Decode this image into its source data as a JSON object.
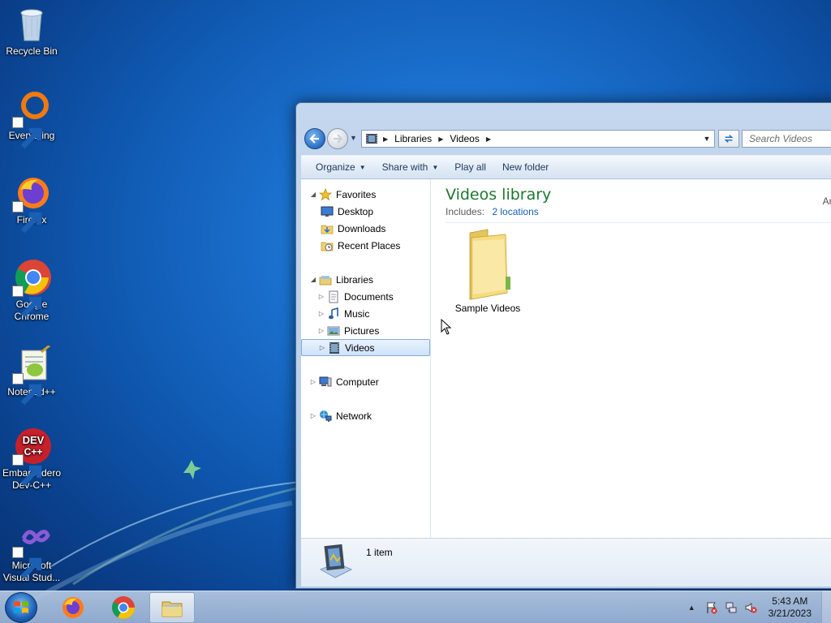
{
  "desktop": {
    "icons": [
      {
        "label": "Recycle Bin",
        "icon": "recycle-bin-icon"
      },
      {
        "label": "Everything",
        "icon": "everything-icon"
      },
      {
        "label": "Firefox",
        "icon": "firefox-icon"
      },
      {
        "label": "Google Chrome",
        "icon": "chrome-icon"
      },
      {
        "label": "Notepad++",
        "icon": "notepad-plus-plus-icon"
      },
      {
        "label": "Embarcadero Dev-C++",
        "icon": "dev-cpp-icon"
      },
      {
        "label": "Microsoft Visual Stud...",
        "icon": "visual-studio-icon"
      }
    ]
  },
  "explorer": {
    "address": {
      "crumbs": [
        "Libraries",
        "Videos"
      ]
    },
    "search": {
      "placeholder": "Search Videos"
    },
    "toolbar": {
      "organize": "Organize",
      "share_with": "Share with",
      "play_all": "Play all",
      "new_folder": "New folder"
    },
    "nav": {
      "favorites": "Favorites",
      "desktop": "Desktop",
      "downloads": "Downloads",
      "recent_places": "Recent Places",
      "libraries": "Libraries",
      "documents": "Documents",
      "music": "Music",
      "pictures": "Pictures",
      "videos": "Videos",
      "computer": "Computer",
      "network": "Network"
    },
    "library": {
      "title": "Videos library",
      "includes_label": "Includes:",
      "includes_link": "2 locations",
      "arrange": "Arran"
    },
    "items": [
      {
        "name": "Sample Videos",
        "icon": "folder-icon"
      }
    ],
    "details": {
      "count": "1 item"
    }
  },
  "taskbar": {
    "apps": [
      "firefox-icon",
      "chrome-icon",
      "file-explorer-icon"
    ],
    "clock": {
      "time": "5:43 AM",
      "date": "3/21/2023"
    }
  },
  "colors": {
    "library_title": "#1d7a30",
    "link": "#1a5fb4",
    "selection": "#cfe3fa"
  }
}
